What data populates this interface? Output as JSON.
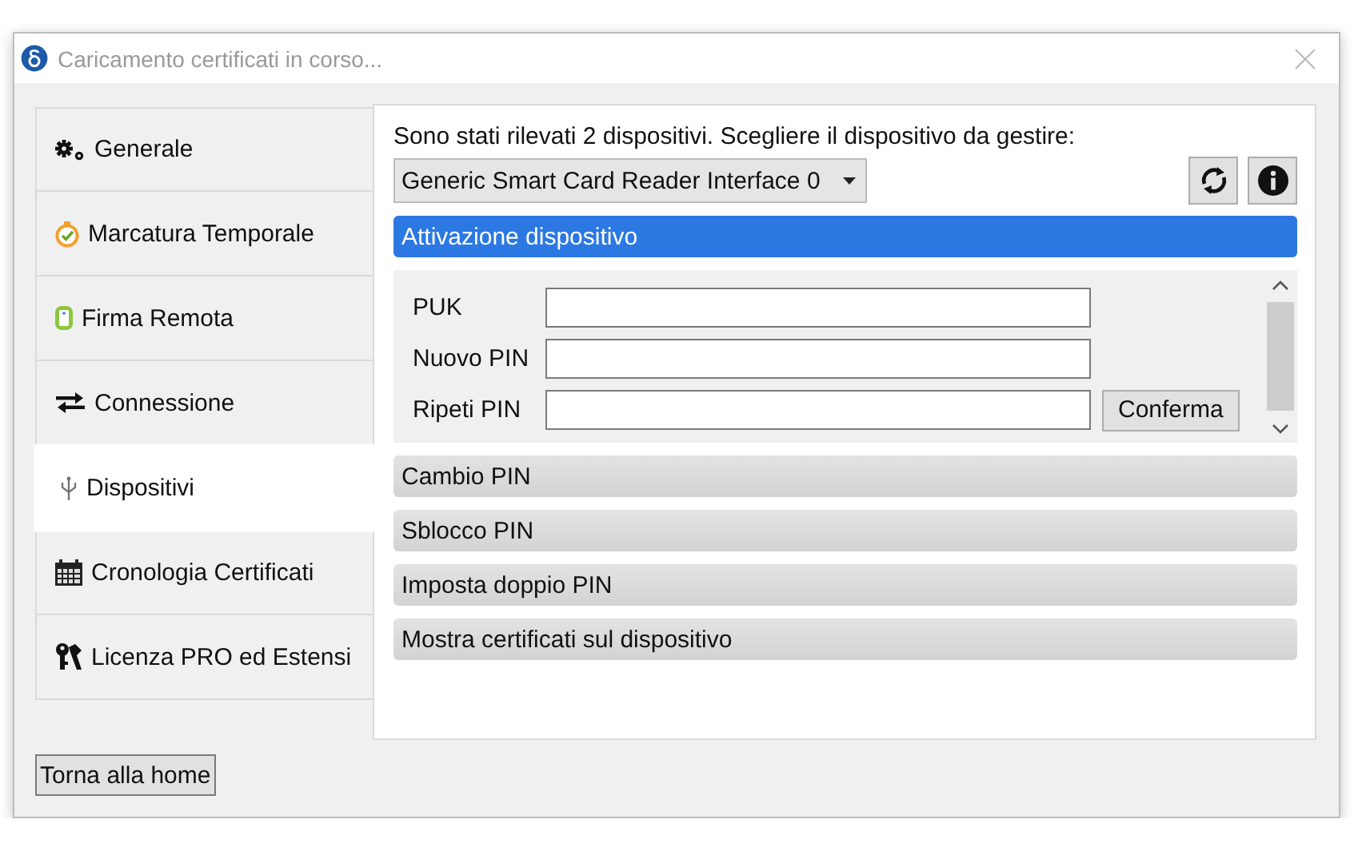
{
  "window": {
    "title": "Caricamento certificati in corso..."
  },
  "sidebar": {
    "items": [
      {
        "label": "Generale",
        "selected": false
      },
      {
        "label": "Marcatura Temporale",
        "selected": false
      },
      {
        "label": "Firma Remota",
        "selected": false
      },
      {
        "label": "Connessione",
        "selected": false
      },
      {
        "label": "Dispositivi",
        "selected": true
      },
      {
        "label": "Cronologia Certificati",
        "selected": false
      },
      {
        "label": "Licenza PRO ed Estensi",
        "selected": false
      }
    ]
  },
  "panel": {
    "intro": "Sono stati rilevati 2 dispositivi. Scegliere il dispositivo da gestire:",
    "device_select": {
      "value": "Generic Smart Card Reader Interface 0"
    },
    "sections": [
      {
        "title": "Attivazione dispositivo",
        "expanded": true,
        "fields": [
          {
            "label": "PUK"
          },
          {
            "label": "Nuovo PIN"
          },
          {
            "label": "Ripeti PIN"
          }
        ],
        "button": "Conferma"
      },
      {
        "title": "Cambio PIN",
        "expanded": false
      },
      {
        "title": "Sblocco PIN",
        "expanded": false
      },
      {
        "title": "Imposta doppio PIN",
        "expanded": false
      },
      {
        "title": "Mostra certificati sul dispositivo",
        "expanded": false
      }
    ]
  },
  "footer": {
    "button": "Torna alla home"
  }
}
